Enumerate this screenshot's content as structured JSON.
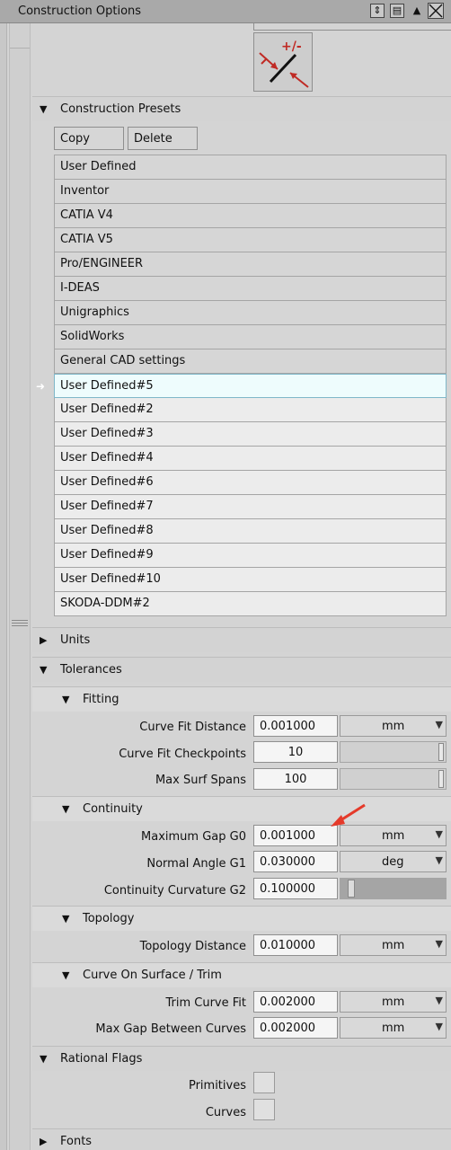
{
  "window": {
    "title": "Construction Options"
  },
  "presets": {
    "section_label": "Construction Presets",
    "copy_label": "Copy",
    "delete_label": "Delete",
    "items": [
      "User Defined",
      "Inventor",
      "CATIA V4",
      "CATIA V5",
      "Pro/ENGINEER",
      "I-DEAS",
      "Unigraphics",
      "SolidWorks",
      "General CAD settings",
      "User Defined#5",
      "User Defined#2",
      "User Defined#3",
      "User Defined#4",
      "User Defined#6",
      "User Defined#7",
      "User Defined#8",
      "User Defined#9",
      "User Defined#10",
      "SKODA-DDM#2"
    ],
    "selected": "User Defined#5"
  },
  "units": {
    "label": "Units"
  },
  "tolerances": {
    "label": "Tolerances",
    "fitting": {
      "label": "Fitting",
      "curve_fit_distance": {
        "label": "Curve Fit Distance",
        "value": "0.001000",
        "unit": "mm"
      },
      "curve_fit_checkpoints": {
        "label": "Curve Fit Checkpoints",
        "value": "10"
      },
      "max_surf_spans": {
        "label": "Max Surf Spans",
        "value": "100"
      }
    },
    "continuity": {
      "label": "Continuity",
      "max_gap_g0": {
        "label": "Maximum Gap G0",
        "value": "0.001000",
        "unit": "mm"
      },
      "normal_angle_g1": {
        "label": "Normal Angle G1",
        "value": "0.030000",
        "unit": "deg"
      },
      "continuity_curvature_g2": {
        "label": "Continuity Curvature G2",
        "value": "0.100000"
      }
    },
    "topology": {
      "label": "Topology",
      "topology_distance": {
        "label": "Topology Distance",
        "value": "0.010000",
        "unit": "mm"
      }
    },
    "curve_on_surface": {
      "label": "Curve On Surface / Trim",
      "trim_curve_fit": {
        "label": "Trim Curve Fit",
        "value": "0.002000",
        "unit": "mm"
      },
      "max_gap_between_curves": {
        "label": "Max Gap Between Curves",
        "value": "0.002000",
        "unit": "mm"
      }
    }
  },
  "rational_flags": {
    "label": "Rational Flags",
    "primitives": {
      "label": "Primitives"
    },
    "curves": {
      "label": "Curves"
    }
  },
  "fonts": {
    "label": "Fonts"
  },
  "colors": {
    "accent_arrow": "#e53a2a",
    "selected_row": "#eefcfd"
  }
}
